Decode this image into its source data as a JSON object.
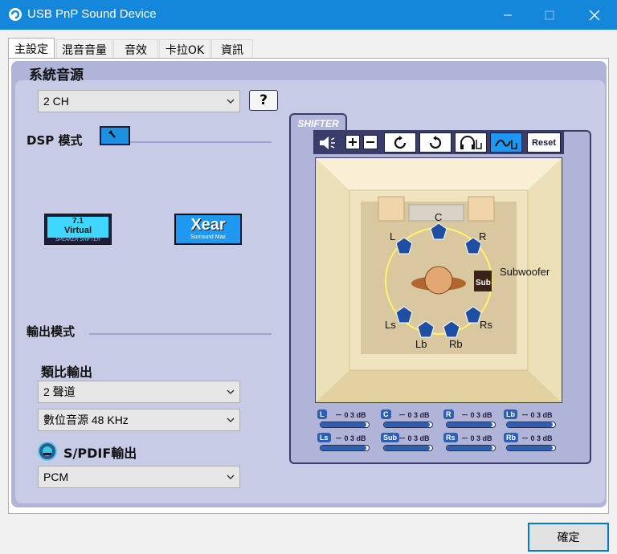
{
  "window": {
    "title": "USB PnP Sound Device"
  },
  "tabs": [
    {
      "label": "主設定",
      "active": true
    },
    {
      "label": "混音音量"
    },
    {
      "label": "音效"
    },
    {
      "label": "卡拉OK"
    },
    {
      "label": "資訊"
    }
  ],
  "system_source": {
    "heading": "系統音源",
    "channel": "2 CH",
    "help_label": "?"
  },
  "dsp": {
    "heading": "DSP 模式",
    "virtual71": {
      "line1": "7.1",
      "line2": "Virtual",
      "line3": "SPEAKER SHIFTER"
    },
    "xear": {
      "line1": "Xear",
      "line2": "Surround Max"
    }
  },
  "output": {
    "heading": "輸出模式",
    "analog_heading": "類比輸出",
    "analog_value": "2 聲道",
    "digital_source": "數位音源 48 KHz",
    "spdif_heading": "S/PDIF輸出",
    "spdif_value": "PCM"
  },
  "shifter": {
    "tab_label": "SHIFTER",
    "reset_label": "Reset",
    "speakers": {
      "C": "C",
      "L": "L",
      "R": "R",
      "Ls": "Ls",
      "Rs": "Rs",
      "Lb": "Lb",
      "Rb": "Rb",
      "Sub": "Sub",
      "Subwoofer": "Subwoofer"
    },
    "levels": [
      {
        "tag": "L",
        "value": "－ 0 3 dB",
        "level": 0.95
      },
      {
        "tag": "C",
        "value": "－ 0 3 dB",
        "level": 0.95
      },
      {
        "tag": "R",
        "value": "－ 0 3 dB",
        "level": 0.95
      },
      {
        "tag": "Lb",
        "value": "－ 0 3 dB",
        "level": 0.95
      },
      {
        "tag": "Ls",
        "value": "－ 0 3 dB",
        "level": 0.95
      },
      {
        "tag": "Sub",
        "value": "－ 0 3 dB",
        "level": 0.95
      },
      {
        "tag": "Rs",
        "value": "－ 0 3 dB",
        "level": 0.95
      },
      {
        "tag": "Rb",
        "value": "－ 0 3 dB",
        "level": 0.95
      }
    ]
  },
  "footer": {
    "ok_label": "確定"
  },
  "colors": {
    "titlebar": "#1587db",
    "accent": "#2f5fb0",
    "panel": "#c8cbe6",
    "dark": "#3a3d6a"
  }
}
